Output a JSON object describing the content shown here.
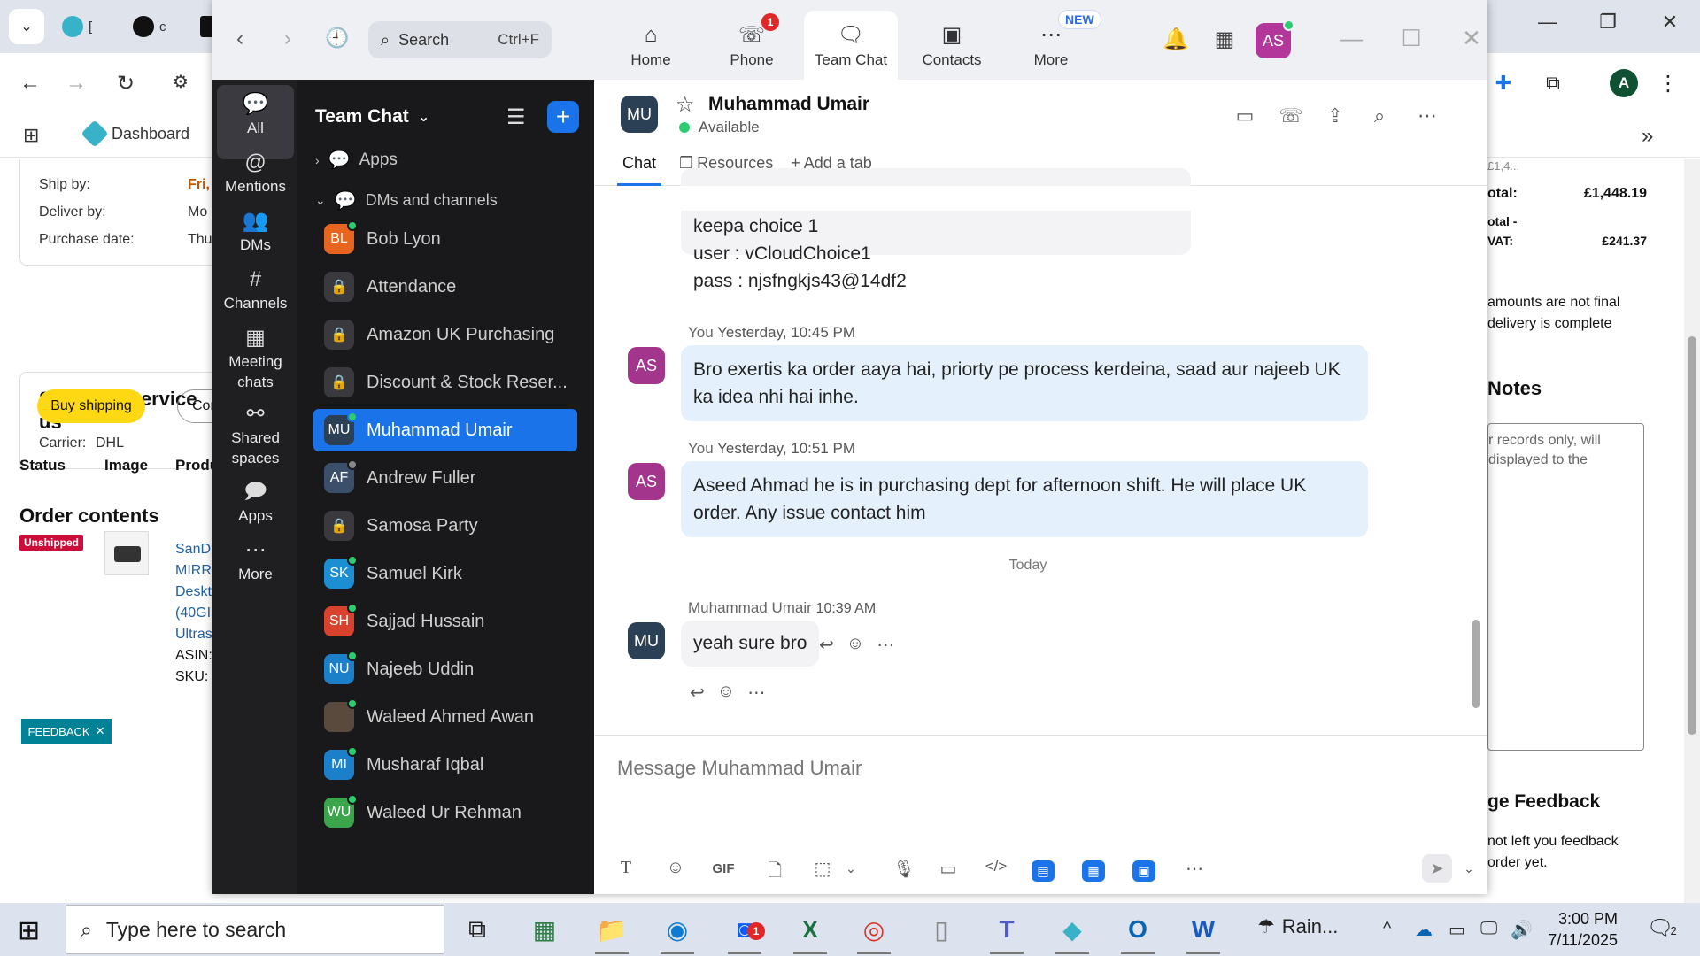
{
  "browser": {
    "tabs": [
      {
        "label": "[",
        "color": "#38b2c8"
      },
      {
        "label": "c",
        "color": "#111111"
      },
      {
        "label": "",
        "color": "#111111"
      }
    ],
    "bookmarks": {
      "dashboard": "Dashboard"
    },
    "profile_initial": "A"
  },
  "bg_left": {
    "ship_by_label": "Ship by:",
    "ship_by_value": "Fri,",
    "deliver_by_label": "Deliver by:",
    "deliver_by_value": "Mo",
    "purchase_date_label": "Purchase date:",
    "purchase_date_value": "Thu",
    "shipping_service_title": "Shipping Service us",
    "carrier_label": "Carrier:",
    "carrier_value": "DHL",
    "order_contents_title": "Order contents",
    "buy_shipping": "Buy shipping",
    "con_button": "Con",
    "columns": [
      "Status",
      "Image",
      "Produ"
    ],
    "status_badge": "Unshipped",
    "product_lines": [
      "SanD",
      "MIRR",
      "Deskt",
      "(40GI",
      "Ultras"
    ],
    "asin_label": "ASIN:",
    "sku_label": "SKU:",
    "feedback": "FEEDBACK"
  },
  "bg_right": {
    "total_partial": "£1,4...",
    "total_label": "otal:",
    "total_value": "£1,448.19",
    "subtotal_label": "otal -",
    "vat_label": "VAT:",
    "vat_value": "£241.37",
    "note_line1": "amounts are not final",
    "note_line2": "delivery is complete",
    "notes_title": "Notes",
    "notes_text1": "r records only, will",
    "notes_text2": "displayed to the",
    "feedback_title": "ge Feedback",
    "feedback_text1": "not left you feedback",
    "feedback_text2": "order yet."
  },
  "zoom": {
    "search_placeholder": "Search",
    "search_shortcut": "Ctrl+F",
    "top_tabs": [
      {
        "label": "Home",
        "icon": "home-icon"
      },
      {
        "label": "Phone",
        "icon": "phone-icon",
        "badge": "1"
      },
      {
        "label": "Team Chat",
        "icon": "chat-icon",
        "active": true
      },
      {
        "label": "Contacts",
        "icon": "contacts-icon"
      },
      {
        "label": "More",
        "icon": "more-icon",
        "badge": "NEW"
      }
    ],
    "user_avatar": "AS",
    "rail": [
      {
        "label": "All",
        "active": true
      },
      {
        "label": "Mentions"
      },
      {
        "label": "DMs"
      },
      {
        "label": "Channels"
      },
      {
        "label": "Meeting chats"
      },
      {
        "label": "Shared spaces"
      },
      {
        "label": "Apps"
      },
      {
        "label": "More"
      }
    ],
    "sidebar": {
      "title": "Team Chat",
      "group_apps": "Apps",
      "group_dms": "DMs and channels",
      "items": [
        {
          "name": "Bob Lyon",
          "initials": "BL",
          "color": "#e8651f",
          "online": true
        },
        {
          "name": "Attendance",
          "lock": true
        },
        {
          "name": "Amazon UK Purchasing",
          "lock": true
        },
        {
          "name": "Discount & Stock Reser...",
          "lock": true
        },
        {
          "name": "Muhammad Umair",
          "initials": "MU",
          "color": "#2b3f55",
          "online": true,
          "selected": true
        },
        {
          "name": "Andrew Fuller",
          "initials": "AF",
          "color": "#3b4f6b"
        },
        {
          "name": "Samosa Party",
          "lock": true
        },
        {
          "name": "Samuel Kirk",
          "initials": "SK",
          "color": "#1b8fd2",
          "online": true
        },
        {
          "name": "Sajjad Hussain",
          "initials": "SH",
          "color": "#d9432d",
          "online": true
        },
        {
          "name": "Najeeb Uddin",
          "initials": "NU",
          "color": "#1b7fc9",
          "online": true
        },
        {
          "name": "Waleed Ahmed Awan",
          "initials": "",
          "color": "#5a4a3e",
          "online": true
        },
        {
          "name": "Musharaf Iqbal",
          "initials": "MI",
          "color": "#1b7fc9",
          "online": true
        },
        {
          "name": "Waleed Ur Rehman",
          "initials": "WU",
          "color": "#3aa54a",
          "online": true
        }
      ]
    },
    "chat": {
      "contact_initials": "MU",
      "contact_name": "Muhammad Umair",
      "contact_status": "Available",
      "tabs": [
        "Chat",
        "Resources",
        "Add a tab"
      ],
      "first_message_lines": [
        "keepa choice 1",
        "user : vCloudChoice1",
        "pass : njsfngkjs43@14df2"
      ],
      "msg1_sender": "You",
      "msg1_time": "Yesterday, 10:45 PM",
      "msg1_text": "Bro exertis ka order aaya hai, priorty pe process kerdeina, saad aur najeeb UK ka idea nhi hai inhe.",
      "msg2_sender": "You",
      "msg2_time": "Yesterday, 10:51 PM",
      "msg2_text": "Aseed Ahmad he is in purchasing dept for afternoon shift. He will place UK order. Any issue contact him",
      "my_initials": "AS",
      "day_separator": "Today",
      "msg3_sender": "Muhammad Umair",
      "msg3_time": "10:39 AM",
      "msg3_text": "yeah sure bro",
      "composer_placeholder": "Message Muhammad Umair",
      "gif_label": "GIF"
    }
  },
  "taskbar": {
    "search_placeholder": "Type here to search",
    "weather": "Rain...",
    "time": "3:00 PM",
    "date": "7/11/2025",
    "notif_count": "2",
    "zoom_badge": "1"
  }
}
